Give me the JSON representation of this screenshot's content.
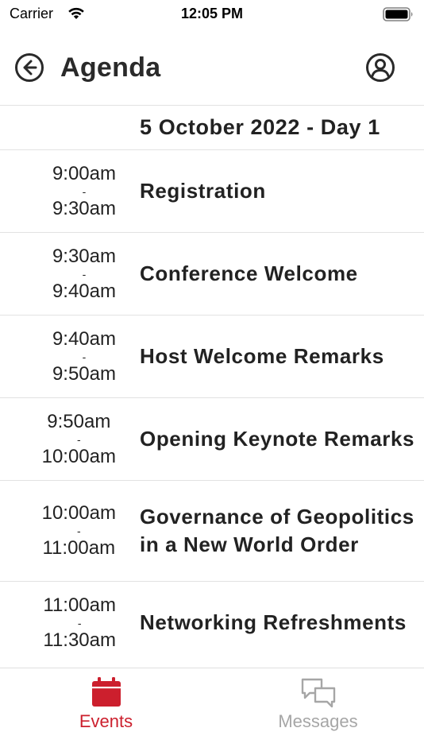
{
  "status": {
    "carrier": "Carrier",
    "time": "12:05 PM"
  },
  "nav": {
    "title": "Agenda",
    "back_icon": "back-circle-arrow-icon",
    "profile_icon": "user-circle-icon"
  },
  "day": {
    "label": "5 October 2022 - Day 1"
  },
  "sessions": [
    {
      "start": "9:00am",
      "sep": "-",
      "end": "9:30am",
      "title": "Registration"
    },
    {
      "start": "9:30am",
      "sep": "-",
      "end": "9:40am",
      "title": "Conference Welcome"
    },
    {
      "start": "9:40am",
      "sep": "-",
      "end": "9:50am",
      "title": "Host Welcome Remarks"
    },
    {
      "start": "9:50am",
      "sep": "-",
      "end": "10:00am",
      "title": "Opening Keynote Remarks"
    },
    {
      "start": "10:00am",
      "sep": "-",
      "end": "11:00am",
      "title": "Governance of Geopolitics in a New World Order"
    },
    {
      "start": "11:00am",
      "sep": "-",
      "end": "11:30am",
      "title": "Networking Refreshments"
    }
  ],
  "tabs": {
    "events": {
      "label": "Events",
      "icon": "calendar-icon"
    },
    "messages": {
      "label": "Messages",
      "icon": "chat-bubbles-icon"
    }
  },
  "colors": {
    "accent": "#cc1f2d",
    "inactive": "#a6a6a6",
    "divider": "#e2e2e2"
  }
}
